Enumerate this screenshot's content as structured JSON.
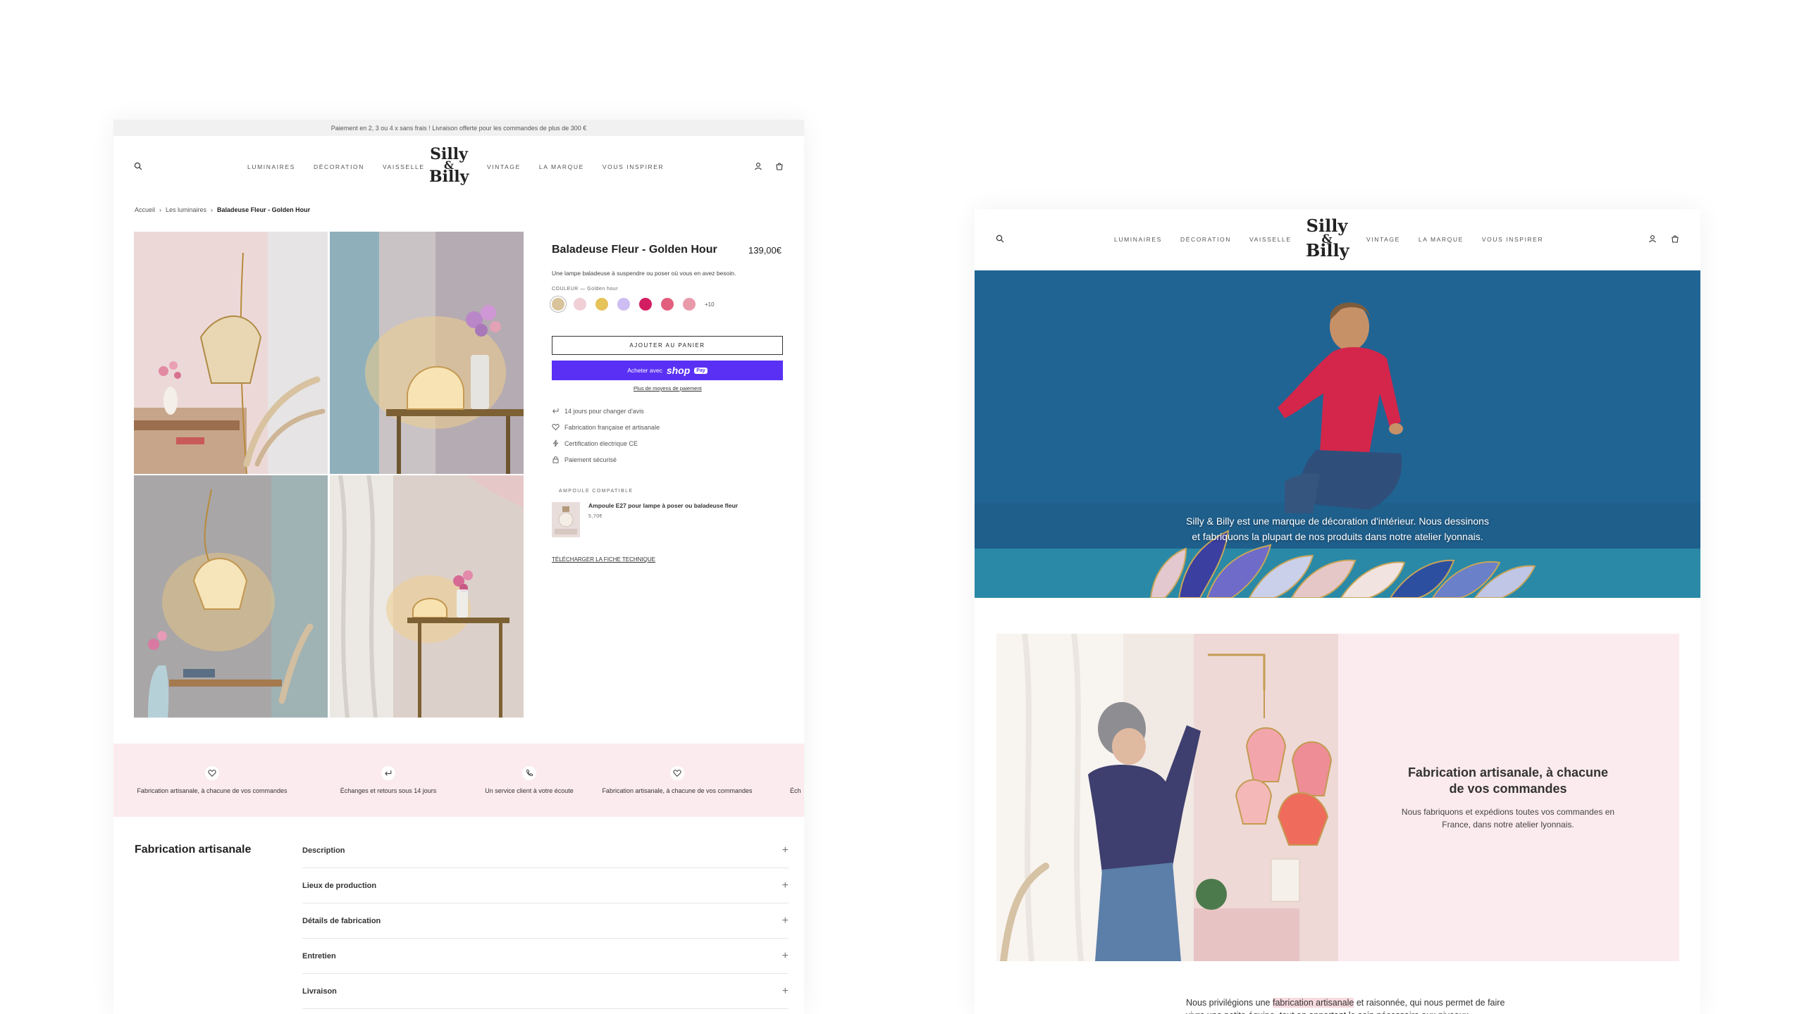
{
  "left": {
    "topbar": "Paiement en 2, 3 ou 4 x sans frais ! Livraison offerte pour les commandes de plus de 300 €",
    "nav_left": [
      "LUMINAIRES",
      "DÉCORATION",
      "VAISSELLE"
    ],
    "nav_right": [
      "VINTAGE",
      "LA MARQUE",
      "VOUS INSPIRER"
    ],
    "logo": {
      "line1": "Silly",
      "amp": "&",
      "line2": "Billy"
    },
    "breadcrumb": {
      "home": "Accueil",
      "sep": "›",
      "category": "Les luminaires",
      "current": "Baladeuse Fleur - Golden Hour"
    },
    "product": {
      "title": "Baladeuse Fleur - Golden Hour",
      "price": "139,00€",
      "description": "Une lampe baladeuse à suspendre ou poser où vous en avez besoin.",
      "color_label": "COULEUR",
      "color_value": "Golden hour",
      "swatch_colors": [
        "#d9c39a",
        "#f0cfd7",
        "#e6c25a",
        "#cdbdf2",
        "#d31d62",
        "#e25f7e",
        "#e99aaa"
      ],
      "swatch_more": "+10",
      "add_to_cart": "AJOUTER AU PANIER",
      "buy_with": "Acheter avec",
      "shop_word": "shop",
      "pay_word": "Pay",
      "more_payment": "Plus de moyens de paiement",
      "features": [
        "14 jours pour changer d'avis",
        "Fabrication française et artisanale",
        "Certification électrique CE",
        "Paiement sécurisé"
      ],
      "compatible_label": "AMPOULE COMPATIBLE",
      "compatible_name": "Ampoule E27 pour lampe à poser ou baladeuse fleur",
      "compatible_price": "5,70€",
      "tech_sheet": "TÉLÉCHARGER LA FICHE TECHNIQUE"
    },
    "band": [
      {
        "icon": "heart-icon",
        "label": "Fabrication artisanale, à chacune de vos commandes"
      },
      {
        "icon": "return-icon",
        "label": "Échanges et retours sous 14 jours"
      },
      {
        "icon": "phone-icon",
        "label": "Un service client à votre écoute"
      },
      {
        "icon": "heart-icon",
        "label": "Fabrication artisanale, à chacune de vos commandes"
      },
      {
        "icon": "return-icon",
        "label": "Éch"
      }
    ],
    "section_title": "Fabrication artisanale",
    "accordion": [
      "Description",
      "Lieux de production",
      "Détails de fabrication",
      "Entretien",
      "Livraison"
    ],
    "plus_sign": "+"
  },
  "right": {
    "nav_left": [
      "LUMINAIRES",
      "DÉCORATION",
      "VAISSELLE"
    ],
    "nav_right": [
      "VINTAGE",
      "LA MARQUE",
      "VOUS INSPIRER"
    ],
    "logo": {
      "line1": "Silly",
      "amp": "&",
      "line2": "Billy"
    },
    "hero_text": "Silly & Billy est une marque de décoration d'intérieur. Nous dessinons et fabriquons la plupart de nos produits dans notre atelier lyonnais.",
    "side_title": "Fabrication artisanale, à chacune de vos commandes",
    "side_body": "Nous fabriquons et expédions toutes vos commandes en France, dans notre atelier lyonnais.",
    "bottom_pre": "Nous privilégions une",
    "bottom_highlight": "fabrication artisanale",
    "bottom_post": "et raisonnée, qui nous permet de faire vivre une petite équipe, tout en apportant le soin nécessaire aux niveaux"
  },
  "colors": {
    "accent_shop": "#5a31f4",
    "band_pink": "#fcebee",
    "hero_blue": "#1e5f8e"
  }
}
